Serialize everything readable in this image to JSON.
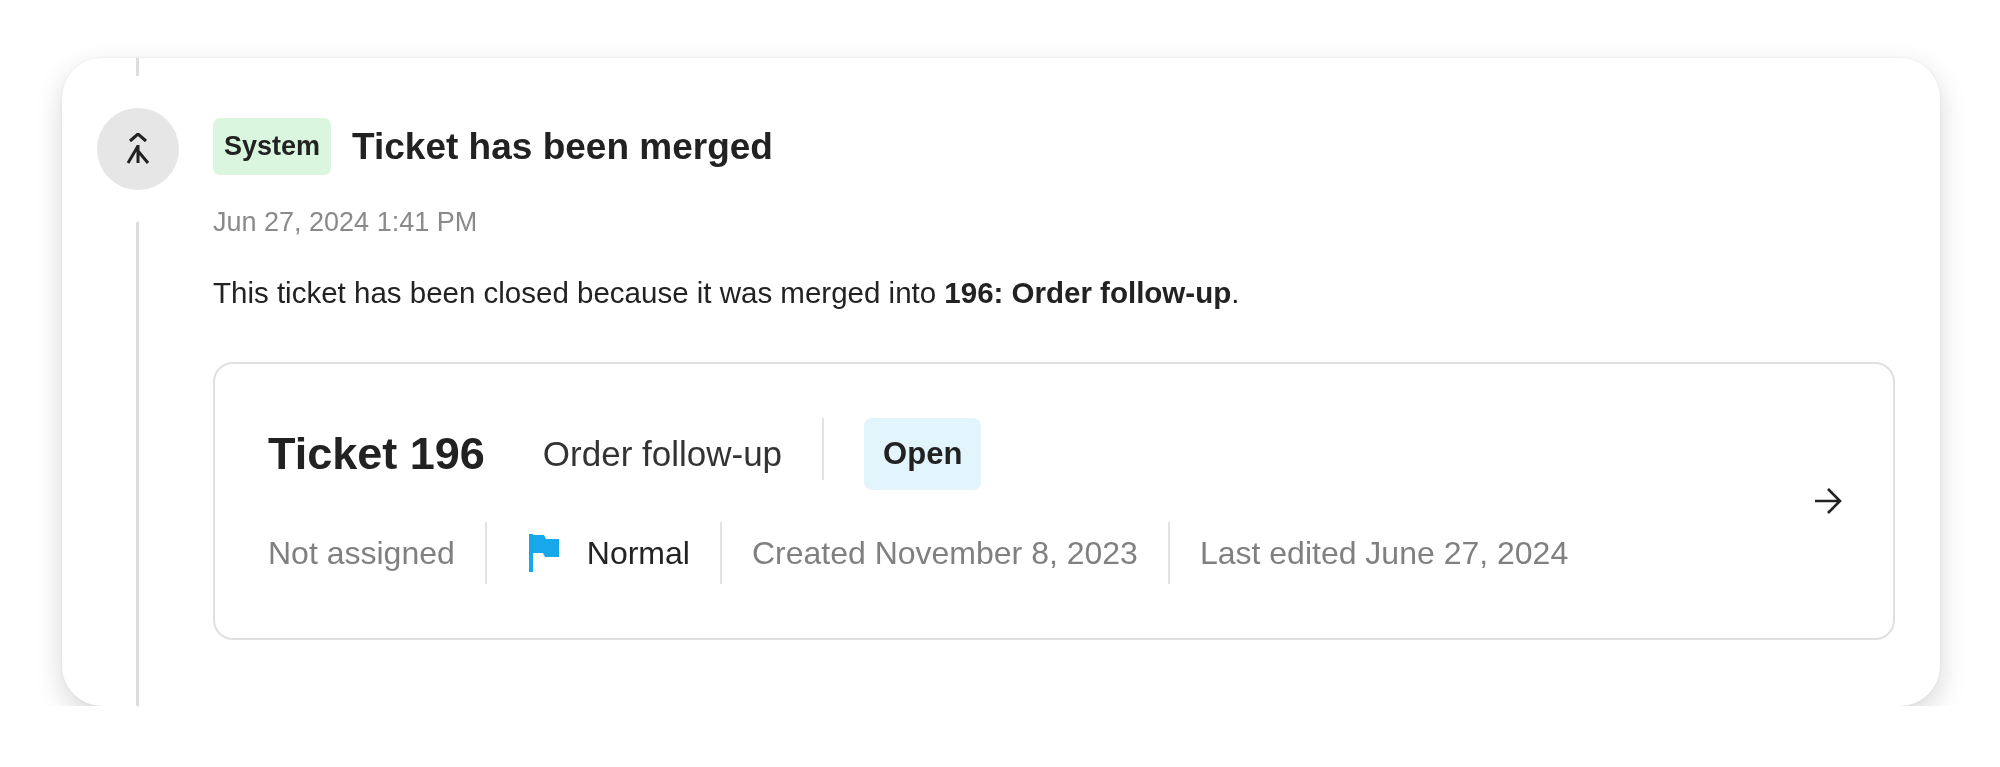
{
  "event": {
    "badge": "System",
    "title": "Ticket has been merged",
    "date": "Jun 27, 2024 1:41 PM",
    "message": "This ticket has been closed because it was merged into **196: Order follow-up**.",
    "ticket": {
      "title": "Ticket 196",
      "subject": "Order follow-up",
      "status": "Open",
      "assignee": "Not assigned",
      "priority": "Normal",
      "created": "Created November 8, 2023",
      "last_edited": "Last edited June 27, 2024"
    }
  }
}
